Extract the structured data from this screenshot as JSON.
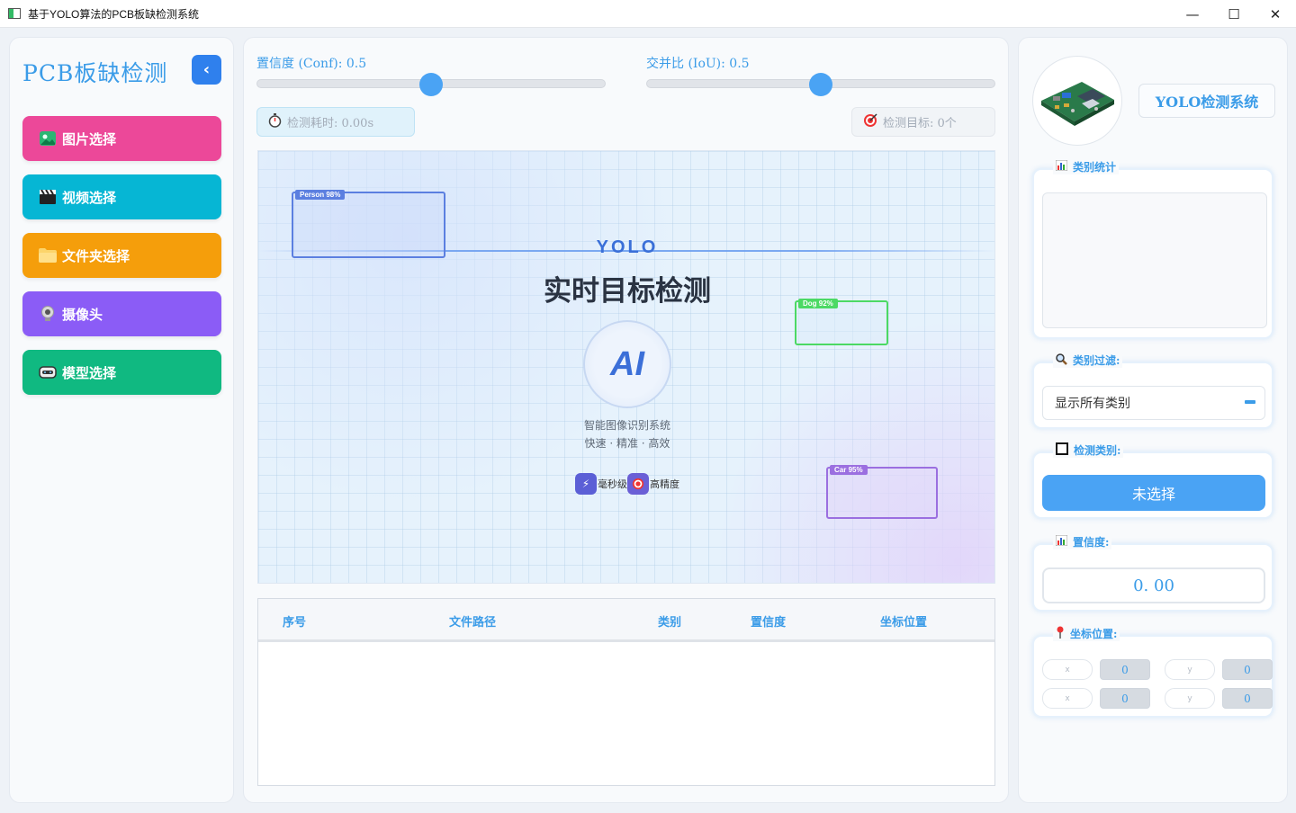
{
  "window": {
    "title": "基于YOLO算法的PCB板缺检测系统",
    "minimize_glyph": "—",
    "maximize_glyph": "☐",
    "close_glyph": "✕"
  },
  "sidebar": {
    "brand": "PCB板缺检测",
    "collapse_glyph": "‹",
    "items": [
      {
        "label": "图片选择",
        "icon": "image-icon",
        "glyph": "🏞",
        "color": "#ec4899"
      },
      {
        "label": "视频选择",
        "icon": "clapper-icon",
        "glyph": "🎬",
        "color": "#06b6d4"
      },
      {
        "label": "文件夹选择",
        "icon": "folder-icon",
        "glyph": "📁",
        "color": "#f59e0b"
      },
      {
        "label": "摄像头",
        "icon": "webcam-icon",
        "glyph": "◉",
        "color": "#8b5cf6"
      },
      {
        "label": "模型选择",
        "icon": "robot-icon",
        "glyph": "▣",
        "color": "#10b981"
      }
    ]
  },
  "controls": {
    "conf_label": "置信度 (Conf): 0.5",
    "iou_label": "交并比 (IoU): 0.5",
    "conf_value": 0.5,
    "iou_value": 0.5,
    "time_label": "检测耗时: 0.00s",
    "time_icon": "stopwatch-icon",
    "target_label": "检测目标: 0个",
    "target_icon": "target-icon"
  },
  "preview": {
    "yolo": "YOLO",
    "title": "实时目标检测",
    "ai": "AI",
    "sub1": "智能图像识别系统",
    "sub2": "快速 · 精准 · 高效",
    "chip1": "毫秒级",
    "chip2": "高精度",
    "boxes": [
      {
        "tag": "Person 98%",
        "color": "#5b7fe0"
      },
      {
        "tag": "Dog 92%",
        "color": "#4cd964"
      },
      {
        "tag": "Car 95%",
        "color": "#9b6fe0"
      }
    ]
  },
  "table": {
    "headers": [
      "序号",
      "文件路径",
      "类别",
      "置信度",
      "坐标位置"
    ],
    "rows": []
  },
  "right": {
    "system_title": "YOLO检测系统",
    "stats_label": "类别统计",
    "stats_icon": "bar-chart-icon",
    "filter_label": "类别过滤:",
    "filter_icon": "magnifier-icon",
    "filter_value": "显示所有类别",
    "class_label": "检测类别:",
    "class_icon": "square-icon",
    "class_value": "未选择",
    "conf_label": "置信度:",
    "conf_icon": "bar-chart-icon",
    "conf_value": "0. 00",
    "coord_label": "坐标位置:",
    "coord_icon": "pin-icon",
    "coords": [
      {
        "a_label": "x",
        "a_value": "0",
        "b_label": "y",
        "b_value": "0"
      },
      {
        "a_label": "x",
        "a_value": "0",
        "b_label": "y",
        "b_value": "0"
      }
    ]
  }
}
